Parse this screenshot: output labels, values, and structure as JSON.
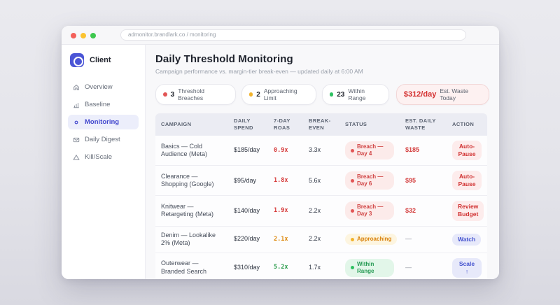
{
  "browser": {
    "url": "admonitor.brandlark.co / monitoring"
  },
  "sidebar": {
    "brand": "Client",
    "items": [
      {
        "label": "Overview",
        "icon": "home-icon",
        "active": false
      },
      {
        "label": "Baseline",
        "icon": "bar-chart-icon",
        "active": false
      },
      {
        "label": "Monitoring",
        "icon": "dot-icon",
        "active": true
      },
      {
        "label": "Daily Digest",
        "icon": "mail-icon",
        "active": false
      },
      {
        "label": "Kill/Scale",
        "icon": "triangle-icon",
        "active": false
      }
    ]
  },
  "header": {
    "title": "Daily Threshold Monitoring",
    "subtitle": "Campaign performance vs. margin-tier break-even — updated daily at 6:00 AM"
  },
  "summary": {
    "badges": [
      {
        "count": "3",
        "label": "Threshold Breaches",
        "dot_color": "#e25555"
      },
      {
        "count": "2",
        "label": "Approaching Limit",
        "dot_color": "#f2b32c"
      },
      {
        "count": "23",
        "label": "Within Range",
        "dot_color": "#2fc162"
      }
    ],
    "waste": {
      "value": "$312/day",
      "label": "Est. Waste Today"
    }
  },
  "table": {
    "columns": [
      "Campaign",
      "Daily Spend",
      "7-Day ROAS",
      "Break-Even",
      "Status",
      "Est. Daily Waste",
      "Action"
    ],
    "rows": [
      {
        "campaign": "Basics — Cold Audience (Meta)",
        "daily_spend": "$185/day",
        "roas": "0.9x",
        "break_even": "3.3x",
        "status": {
          "text": "Breach — Day 4",
          "type": "breach"
        },
        "est_waste": "$185",
        "action": {
          "label": "Auto-Pause",
          "type": "danger"
        }
      },
      {
        "campaign": "Clearance — Shopping (Google)",
        "daily_spend": "$95/day",
        "roas": "1.8x",
        "break_even": "5.6x",
        "status": {
          "text": "Breach — Day 6",
          "type": "breach"
        },
        "est_waste": "$95",
        "action": {
          "label": "Auto-Pause",
          "type": "danger"
        }
      },
      {
        "campaign": "Knitwear — Retargeting (Meta)",
        "daily_spend": "$140/day",
        "roas": "1.9x",
        "break_even": "2.2x",
        "status": {
          "text": "Breach — Day 3",
          "type": "breach"
        },
        "est_waste": "$32",
        "action": {
          "label": "Review Budget",
          "type": "danger"
        }
      },
      {
        "campaign": "Denim — Lookalike 2% (Meta)",
        "daily_spend": "$220/day",
        "roas": "2.1x",
        "break_even": "2.2x",
        "status": {
          "text": "Approaching",
          "type": "approaching"
        },
        "est_waste": "—",
        "action": {
          "label": "Watch",
          "type": "neutral"
        }
      },
      {
        "campaign": "Outerwear — Branded Search",
        "daily_spend": "$310/day",
        "roas": "5.2x",
        "break_even": "1.7x",
        "status": {
          "text": "Within Range",
          "type": "within"
        },
        "est_waste": "—",
        "action": {
          "label": "Scale ↑",
          "type": "neutral"
        }
      }
    ]
  },
  "colors": {
    "accent_indigo": "#4b55d6",
    "status_red": "#d04343",
    "status_amber": "#d9820b",
    "status_green": "#259a53",
    "waste_red": "#d42f2f"
  }
}
